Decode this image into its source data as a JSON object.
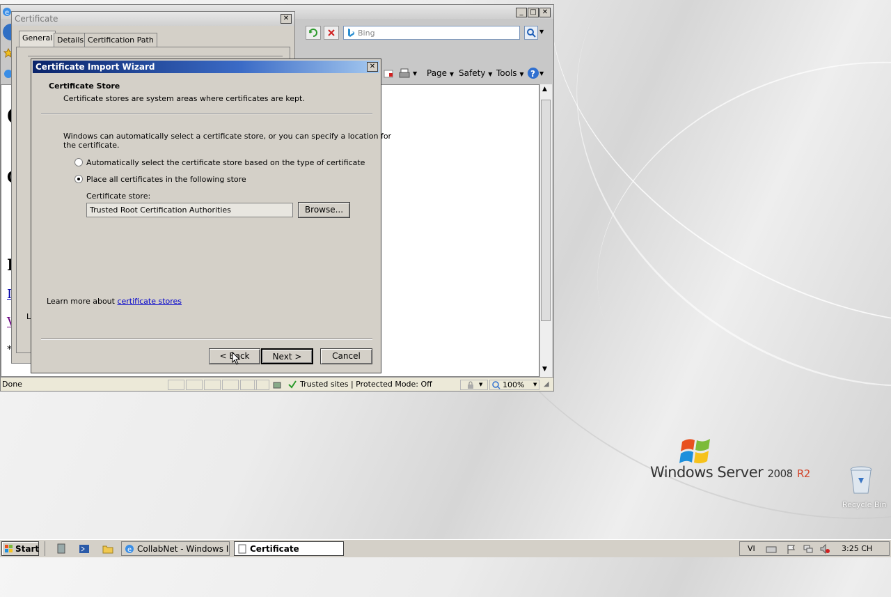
{
  "desktop": {
    "brand_windows": "Windows Server",
    "brand_year": "2008",
    "brand_r2": "R2",
    "recycle_label": "Recycle Bin"
  },
  "ie": {
    "search_placeholder": "Bing",
    "cmd_page": "Page",
    "cmd_safety": "Safety",
    "cmd_tools": "Tools",
    "status_done": "Done",
    "status_zone": "Trusted sites | Protected Mode: Off",
    "zoom": "100%"
  },
  "certificate": {
    "title": "Certificate",
    "tabs": [
      "General",
      "Details",
      "Certification Path"
    ],
    "partial_text": "Le"
  },
  "wizard": {
    "title": "Certificate Import Wizard",
    "heading": "Certificate Store",
    "subheading": "Certificate stores are system areas where certificates are kept.",
    "intro_line1": "Windows can automatically select a certificate store, or you can specify a location for",
    "intro_line2": "the certificate.",
    "radio_auto": "Automatically select the certificate store based on the type of certificate",
    "radio_place": "Place all certificates in the following store",
    "store_label": "Certificate store:",
    "store_value": "Trusted Root Certification Authorities",
    "browse": "Browse...",
    "learn_prefix": "Learn more about ",
    "learn_link": "certificate stores",
    "back": "< Back",
    "next": "Next >",
    "cancel": "Cancel",
    "selected_option": "place"
  },
  "taskbar": {
    "start": "Start",
    "task_ie": "CollabNet - Windows Int...",
    "task_cert": "Certificate",
    "lang": "VI",
    "clock": "3:25 CH"
  }
}
